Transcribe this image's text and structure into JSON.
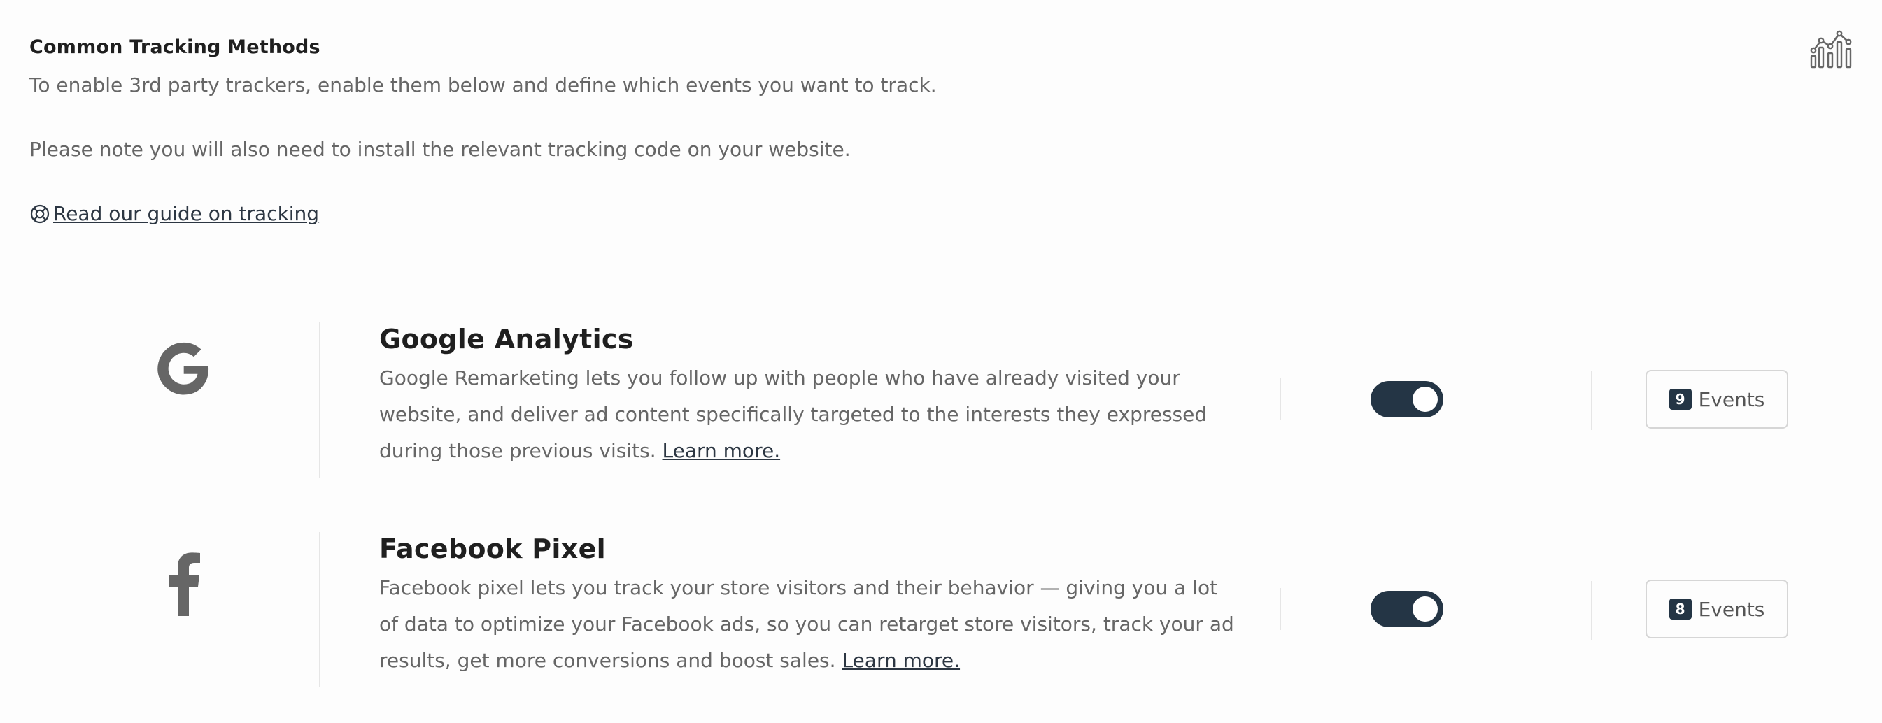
{
  "header": {
    "title": "Common Tracking Methods",
    "description": "To enable 3rd party trackers, enable them below and define which events you want to track.",
    "note": "Please note you will also need to install the relevant tracking code on your website.",
    "guide_link": "Read our guide on tracking",
    "guide_icon": "lifebuoy-icon",
    "corner_icon": "analytics-chart-icon"
  },
  "trackers": [
    {
      "name": "Google Analytics",
      "logo_icon": "google-icon",
      "logo_letter": "G",
      "description": "Google Remarketing lets you follow up with people who have already visited your website, and deliver ad content specifically targeted to the interests they expressed during those previous visits. ",
      "learn_more": "Learn more.",
      "enabled": true,
      "events_count": "9",
      "events_label": "Events"
    },
    {
      "name": "Facebook Pixel",
      "logo_icon": "facebook-icon",
      "logo_letter": "f",
      "description": "Facebook pixel lets you track your store visitors and their behavior — giving you a lot of data to optimize your Facebook ads, so you can retarget store visitors, track your ad results, get more conversions and boost sales. ",
      "learn_more": "Learn more.",
      "enabled": true,
      "events_count": "8",
      "events_label": "Events"
    }
  ],
  "colors": {
    "toggle_on": "#243545",
    "badge_bg": "#243545",
    "logo_gray": "#666666",
    "divider": "#e6e6e6"
  }
}
